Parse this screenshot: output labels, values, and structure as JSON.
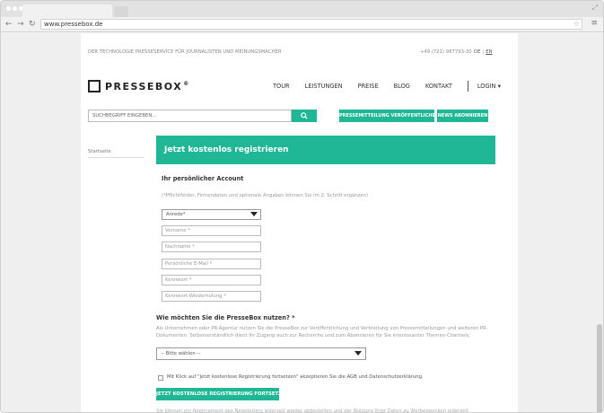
{
  "browser": {
    "url": "www.pressebox.de"
  },
  "header": {
    "tagline": "DER TECHNOLOGIE PRESSESERVICE FÜR JOURNALISTEN UND MEINUNGSMACHER",
    "phone": "+49 (721) 987793-30",
    "lang_de": "DE",
    "lang_separator": "|",
    "lang_en": "EN",
    "logo_text": "PRESSEBOX",
    "logo_mark": "®"
  },
  "nav": {
    "tour": "TOUR",
    "leistungen": "LEISTUNGEN",
    "preise": "PREISE",
    "blog": "BLOG",
    "kontakt": "KONTAKT",
    "login": "LOGIN ▾"
  },
  "search": {
    "placeholder": "SUCHBEGRIFF EINGEBEN...",
    "pm_button": "PRESSEMITTEILUNG VERÖFFENTLICHEN",
    "news_button": "NEWS ABONNIEREN"
  },
  "sidebar": {
    "startseite": "Startseite"
  },
  "form": {
    "banner_title": "Jetzt kostenlos registrieren",
    "account_heading": "Ihr persönlicher Account",
    "hint": "(*Pflichtfelder, Firmendaten und optionale Angaben können Sie im 2. Schritt ergänzen)",
    "salutation": "Anrede*",
    "first_name": "Vorname *",
    "last_name": "Nachname *",
    "email": "Persönliche E-Mail *",
    "password": "Kennwort *",
    "password_repeat": "Kennwort-Wiederholung *",
    "usage_heading": "Wie möchten Sie die PresseBox nutzen? *",
    "usage_text": "Als Unternehmen oder PR-Agentur nutzen Sie die PresseBox zur Veröffentlichung und Verbreitung von Pressemitteilungen und weiteren PR-Dokumenten. Selbstverständlich dient Ihr Zugang auch zur Recherche und zum Abonnieren für Sie interessanter Themen-Channels.",
    "usage_select": "-- Bitte wählen --",
    "agb_label": "Mit Klick auf \"Jetzt kostenlose Registrierung fortsetzen\" akzeptieren Sie die AGB und Datenschutzerklärung.",
    "submit": "JETZT KOSTENLOSE REGISTRIERUNG FORTSETZEN",
    "bottom_text": "Sie können ein Abonnement des Newsletters jederzeit wieder abbestellen und der Nutzung Ihrer Daten zu Werbezwecken jederzeit widersprechen, bzw. ihre"
  },
  "colors": {
    "accent": "#1fb796"
  }
}
